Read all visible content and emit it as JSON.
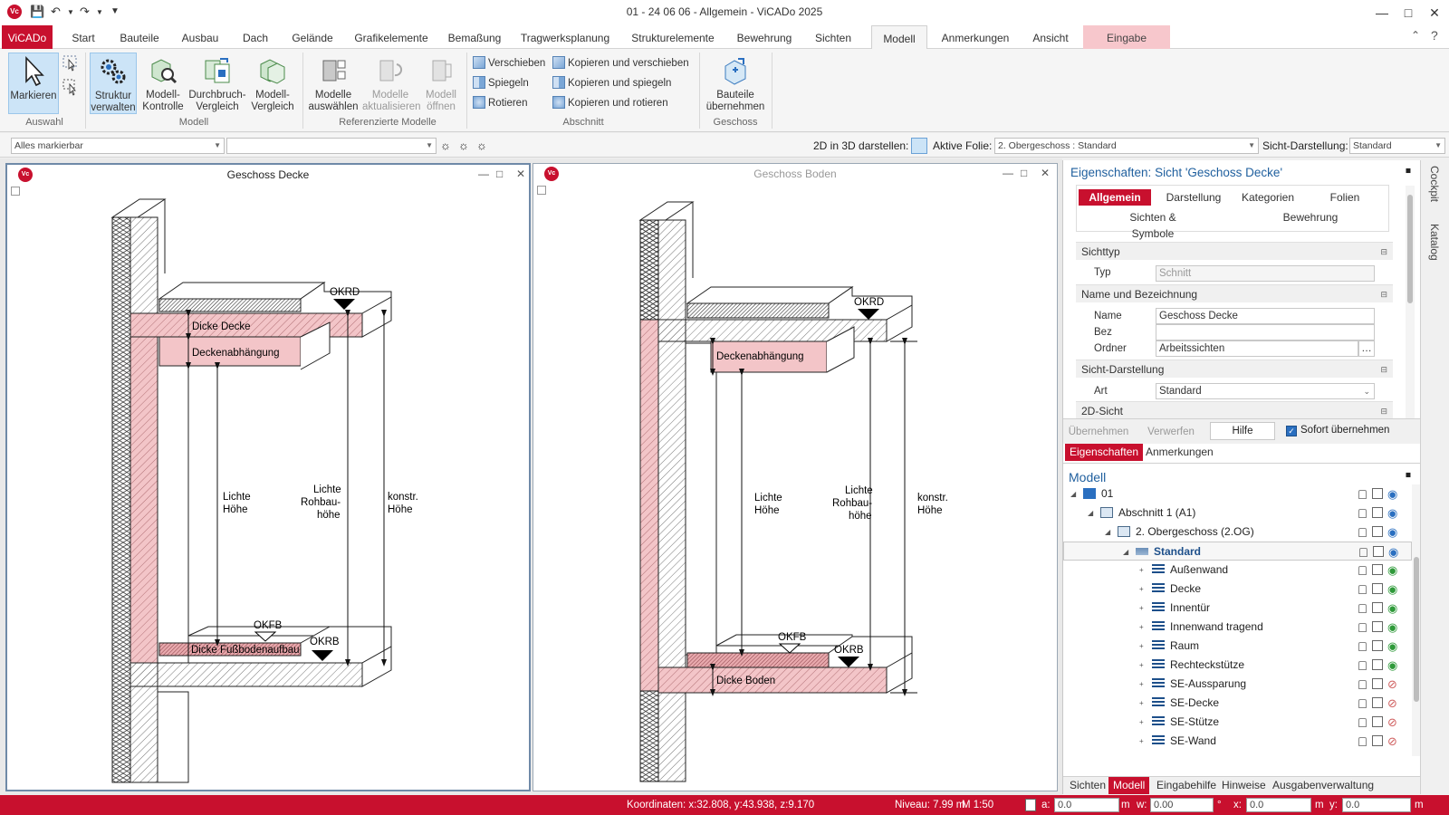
{
  "window": {
    "title": "01 - 24 06 06 - Allgemein - ViCADo 2025"
  },
  "tabs": [
    "ViCADo",
    "Start",
    "Bauteile",
    "Ausbau",
    "Dach",
    "Gelände",
    "Grafikelemente",
    "Bemaßung",
    "Tragwerksplanung",
    "Strukturelemente",
    "Bewehrung",
    "Sichten",
    "Modell",
    "Anmerkungen",
    "Ansicht",
    "Eingabe"
  ],
  "ribbon": {
    "markieren": "Markieren",
    "auswahl": "Auswahl",
    "struktur1": "Struktur",
    "struktur2": "verwalten",
    "mk1": "Modell-",
    "mk2": "Kontrolle",
    "dv1": "Durchbruch-",
    "dv2": "Vergleich",
    "mv1": "Modell-",
    "mv2": "Vergleich",
    "modell": "Modell",
    "ma1": "Modelle",
    "ma2": "auswählen",
    "mu1": "Modelle",
    "mu2": "aktualisieren",
    "mo1": "Modell",
    "mo2": "öffnen",
    "refmod": "Referenzierte Modelle",
    "verschieben": "Verschieben",
    "spiegeln": "Spiegeln",
    "rotieren": "Rotieren",
    "kv": "Kopieren und verschieben",
    "ks": "Kopieren und spiegeln",
    "kr": "Kopieren und rotieren",
    "abschnitt": "Abschnitt",
    "bu1": "Bauteile",
    "bu2": "übernehmen",
    "geschoss": "Geschoss"
  },
  "toolbar": {
    "filter": "Alles markierbar",
    "d2d3": "2D in 3D darstellen:",
    "folie_label": "Aktive Folie:",
    "folie": "2. Obergeschoss : Standard",
    "sicht_label": "Sicht-Darstellung:",
    "sicht": "Standard"
  },
  "view1": {
    "title": "Geschoss Decke",
    "okrd": "OKRD",
    "dd": "Dicke Decke",
    "da": "Deckenabhängung",
    "lh1": "Lichte",
    "lh2": "Höhe",
    "lr1": "Lichte",
    "lr2": "Rohbau-",
    "lr3": "höhe",
    "kh1": "konstr.",
    "kh2": "Höhe",
    "okfb": "OKFB",
    "okrb": "OKRB",
    "dfa": "Dicke Fußbodenaufbau"
  },
  "view2": {
    "title": "Geschoss Boden",
    "okrd": "OKRD",
    "da": "Deckenabhängung",
    "lh1": "Lichte",
    "lh2": "Höhe",
    "lr1": "Lichte",
    "lr2": "Rohbau-",
    "lr3": "höhe",
    "kh1": "konstr.",
    "kh2": "Höhe",
    "okfb": "OKFB",
    "okrb": "OKRB",
    "db": "Dicke Boden"
  },
  "props": {
    "title": "Eigenschaften: Sicht 'Geschoss Decke'",
    "tabs": [
      "Allgemein",
      "Darstellung",
      "Kategorien",
      "Folien",
      "Sichten & Symbole",
      "Bewehrung"
    ],
    "sec1": "Sichttyp",
    "typ": "Typ",
    "typ_val": "Schnitt",
    "sec2": "Name und Bezeichnung",
    "name": "Name",
    "name_val": "Geschoss Decke",
    "bez": "Bez",
    "ordner": "Ordner",
    "ordner_val": "Arbeitssichten",
    "sec3": "Sicht-Darstellung",
    "art": "Art",
    "art_val": "Standard",
    "sec4": "2D-Sicht",
    "b1": "Übernehmen",
    "b2": "Verwerfen",
    "b3": "Hilfe",
    "sofort": "Sofort übernehmen",
    "t1": "Eigenschaften",
    "t2": "Anmerkungen"
  },
  "model": {
    "title": "Modell",
    "tree": [
      {
        "label": "01",
        "level": 0,
        "bold": false,
        "eye": "on"
      },
      {
        "label": "Abschnitt 1 (A1)",
        "level": 1,
        "bold": false,
        "eye": "on"
      },
      {
        "label": "2. Obergeschoss (2.OG)",
        "level": 2,
        "bold": false,
        "eye": "on"
      },
      {
        "label": "Standard",
        "level": 3,
        "bold": true,
        "eye": "on"
      },
      {
        "label": "Außenwand",
        "level": 4,
        "bold": false,
        "eye": "green"
      },
      {
        "label": "Decke",
        "level": 4,
        "bold": false,
        "eye": "green"
      },
      {
        "label": "Innentür",
        "level": 4,
        "bold": false,
        "eye": "green"
      },
      {
        "label": "Innenwand tragend",
        "level": 4,
        "bold": false,
        "eye": "green"
      },
      {
        "label": "Raum",
        "level": 4,
        "bold": false,
        "eye": "green"
      },
      {
        "label": "Rechteckstütze",
        "level": 4,
        "bold": false,
        "eye": "green"
      },
      {
        "label": "SE-Aussparung",
        "level": 4,
        "bold": false,
        "eye": "off"
      },
      {
        "label": "SE-Decke",
        "level": 4,
        "bold": false,
        "eye": "off"
      },
      {
        "label": "SE-Stütze",
        "level": 4,
        "bold": false,
        "eye": "off"
      },
      {
        "label": "SE-Wand",
        "level": 4,
        "bold": false,
        "eye": "off"
      }
    ],
    "bottom_tabs": [
      "Sichten",
      "Modell",
      "Eingabehilfe",
      "Hinweise",
      "Ausgabenverwaltung"
    ]
  },
  "sidetabs": [
    "Cockpit",
    "Katalog"
  ],
  "status": {
    "coords": "Koordinaten: x:32.808, y:43.938, z:9.170",
    "niveau": "Niveau: 7.99 m",
    "scale": "M 1:50",
    "a": "a:",
    "a_val": "0.0",
    "m": "m",
    "w": "w:",
    "w_val": "0.00",
    "deg": "°",
    "x": "x:",
    "x_val": "0.0",
    "y": "y:",
    "y_val": "0.0"
  }
}
